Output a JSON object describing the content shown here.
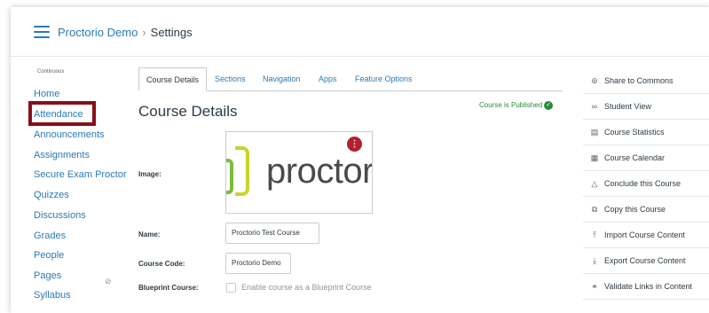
{
  "header": {
    "breadcrumb_course": "Proctorio Demo",
    "breadcrumb_separator": "›",
    "breadcrumb_current": "Settings"
  },
  "sidebar": {
    "term": "Continuous",
    "items": [
      {
        "label": "Home"
      },
      {
        "label": "Attendance"
      },
      {
        "label": "Announcements"
      },
      {
        "label": "Assignments"
      },
      {
        "label": "Secure Exam Proctor"
      },
      {
        "label": "Quizzes"
      },
      {
        "label": "Discussions"
      },
      {
        "label": "Grades"
      },
      {
        "label": "People"
      },
      {
        "label": "Pages"
      },
      {
        "label": "Syllabus"
      }
    ],
    "highlight_color": "#8a0f1a"
  },
  "tabs": [
    {
      "label": "Course Details",
      "active": true
    },
    {
      "label": "Sections"
    },
    {
      "label": "Navigation"
    },
    {
      "label": "Apps"
    },
    {
      "label": "Feature Options"
    }
  ],
  "main": {
    "title": "Course Details",
    "status": "Course is Published",
    "image_label": "Image:",
    "logo_text": "proctor",
    "name_label": "Name:",
    "name_value": "Proctorio Test Course",
    "code_label": "Course Code:",
    "code_value": "Proctorio Demo",
    "blueprint_label": "Blueprint Course:",
    "blueprint_checkbox_label": "Enable course as a Blueprint Course"
  },
  "right_sidebar": [
    {
      "label": "Share to Commons",
      "icon": "share-icon"
    },
    {
      "label": "Student View",
      "icon": "glasses-icon"
    },
    {
      "label": "Course Statistics",
      "icon": "stats-icon"
    },
    {
      "label": "Course Calendar",
      "icon": "calendar-icon"
    },
    {
      "label": "Conclude this Course",
      "icon": "lock-icon"
    },
    {
      "label": "Copy this Course",
      "icon": "copy-icon"
    },
    {
      "label": "Import Course Content",
      "icon": "upload-icon"
    },
    {
      "label": "Export Course Content",
      "icon": "download-icon"
    },
    {
      "label": "Validate Links in Content",
      "icon": "link-icon"
    }
  ],
  "colors": {
    "link": "#2a7ab8",
    "published": "#2a8c3a",
    "accent_red": "#b5202e"
  }
}
